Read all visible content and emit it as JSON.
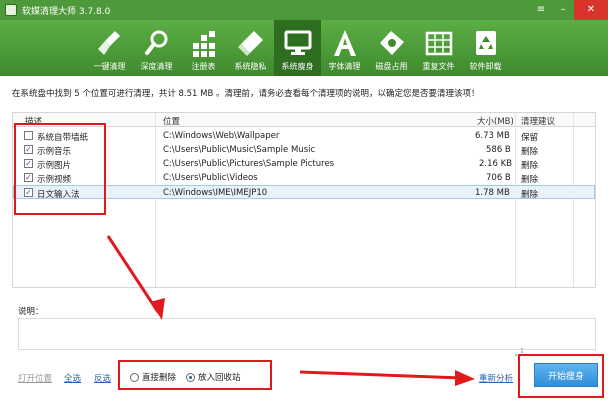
{
  "window": {
    "title": "软媒清理大师 3.7.8.0",
    "controls": [
      "≡",
      "–",
      "✕"
    ]
  },
  "toolbar": {
    "items": [
      {
        "label": "一键清理",
        "icon": "broom-icon"
      },
      {
        "label": "深度清理",
        "icon": "magnifier-icon"
      },
      {
        "label": "注册表",
        "icon": "registry-grid-icon"
      },
      {
        "label": "系统隐私",
        "icon": "eraser-icon"
      },
      {
        "label": "系统瘦身",
        "icon": "monitor-icon",
        "active": true
      },
      {
        "label": "字体清理",
        "icon": "font-a-icon"
      },
      {
        "label": "磁盘占用",
        "icon": "disk-tag-icon"
      },
      {
        "label": "重复文件",
        "icon": "duplicate-grid-icon"
      },
      {
        "label": "软件卸载",
        "icon": "recycle-bin-icon"
      }
    ]
  },
  "info_text": "在系统盘中找到 5 个位置可进行清理，共计 8.51 MB 。清理前，请务必查看每个清理项的说明，以确定您是否要清理该项！",
  "table": {
    "columns": {
      "desc": "描述",
      "location": "位置",
      "size": "大小(MB)",
      "advice": "清理建议"
    },
    "rows": [
      {
        "checked": false,
        "desc": "系统自带墙纸",
        "location": "C:\\Windows\\Web\\Wallpaper",
        "size": "6.73 MB",
        "advice": "保留"
      },
      {
        "checked": true,
        "desc": "示例音乐",
        "location": "C:\\Users\\Public\\Music\\Sample Music",
        "size": "586 B",
        "advice": "删除"
      },
      {
        "checked": true,
        "desc": "示例图片",
        "location": "C:\\Users\\Public\\Pictures\\Sample Pictures",
        "size": "2.16 KB",
        "advice": "删除"
      },
      {
        "checked": true,
        "desc": "示例视频",
        "location": "C:\\Users\\Public\\Videos",
        "size": "706 B",
        "advice": "删除"
      },
      {
        "checked": true,
        "desc": "日文输入法",
        "location": "C:\\Windows\\IME\\IMEJP10",
        "size": "1.78 MB",
        "advice": "删除",
        "selected": true
      }
    ]
  },
  "description": {
    "label": "说明："
  },
  "footer": {
    "open_location": "打开位置",
    "select_all": "全选",
    "invert": "反选",
    "radio_direct": "直接删除",
    "radio_recycle": "放入回收站",
    "rescan": "重新分析",
    "clean_button": "开始瘦身"
  },
  "colors": {
    "toolbar_green": "#4e9a3a",
    "active_tab": "#2e6e20",
    "annotation_red": "#e0191d",
    "button_blue": "#2f8fd8"
  }
}
